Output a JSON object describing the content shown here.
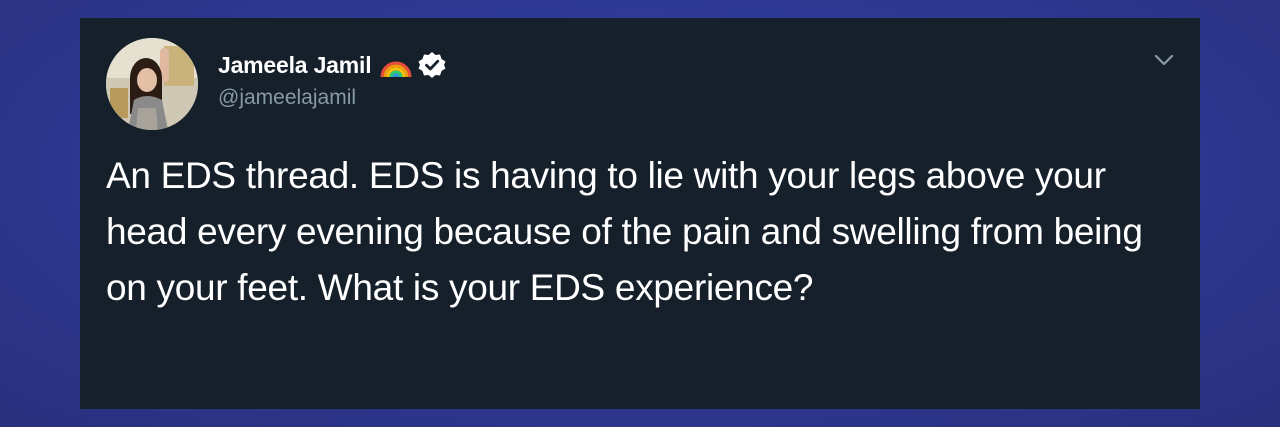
{
  "tweet": {
    "author": {
      "display_name": "Jameela Jamil",
      "handle": "@jameelajamil",
      "badges": [
        "rainbow-icon",
        "verified-icon"
      ]
    },
    "text": "An EDS thread. EDS is having to lie with your legs above your head every evening because of the pain and swelling from being on your feet. What is your EDS experience?",
    "menu_icon": "chevron-down-icon"
  },
  "colors": {
    "background": "#2f3a95",
    "card": "#15202b",
    "text_primary": "#ffffff",
    "text_secondary": "#8899a6",
    "verified_badge": "#ffffff"
  }
}
